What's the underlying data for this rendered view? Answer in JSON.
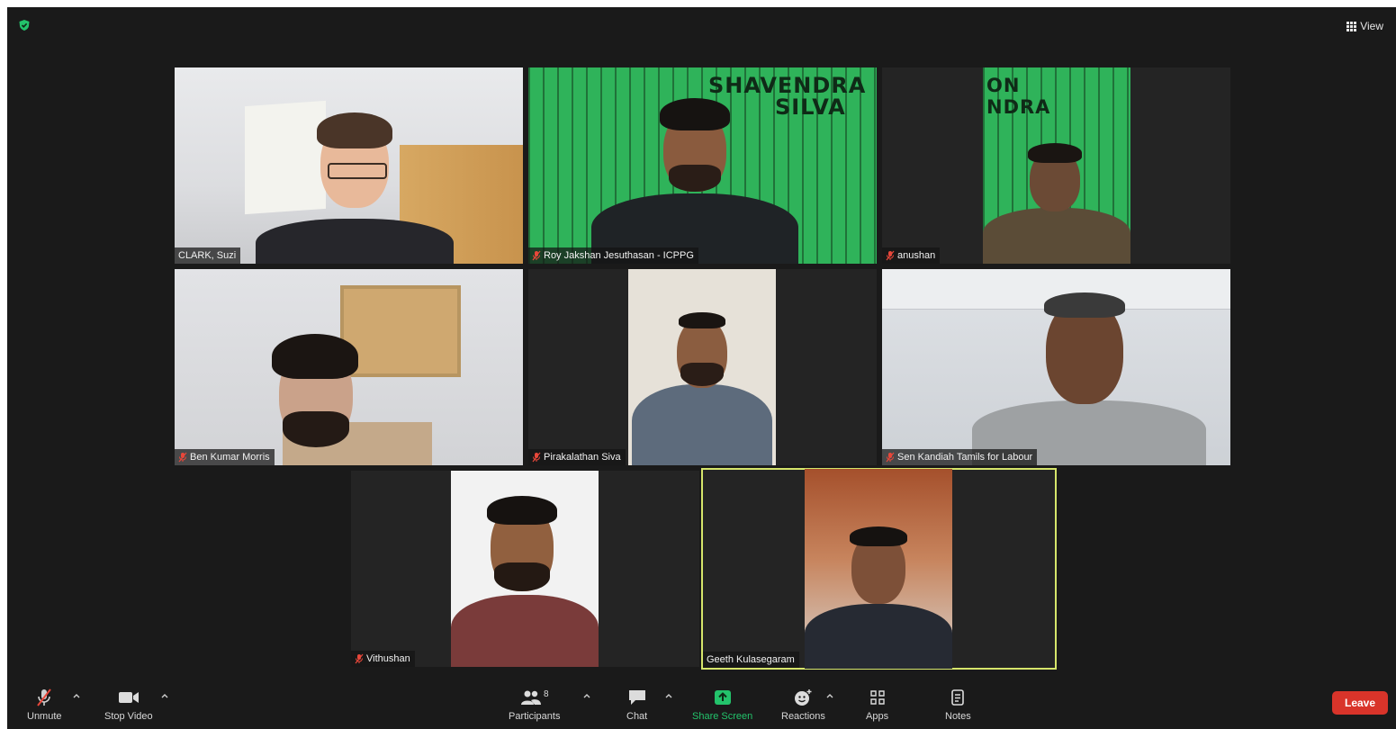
{
  "header": {
    "view_label": "View"
  },
  "participants": [
    {
      "name": "CLARK, Suzi",
      "muted": false
    },
    {
      "name": "Roy Jakshan Jesuthasan - ICPPG",
      "muted": true
    },
    {
      "name": "anushan",
      "muted": true
    },
    {
      "name": "Ben Kumar Morris",
      "muted": true
    },
    {
      "name": "Pirakalathan Siva",
      "muted": true
    },
    {
      "name": "Sen Kandiah Tamils for Labour",
      "muted": true
    },
    {
      "name": "Vithushan",
      "muted": true
    },
    {
      "name": "Geeth Kulasegaram",
      "muted": false,
      "active_speaker": true
    }
  ],
  "posters": {
    "roy": {
      "lines": [
        "SHAVENDRA",
        "SILVA"
      ]
    },
    "anushan": {
      "lines": [
        "ON",
        "NDRA"
      ]
    }
  },
  "toolbar": {
    "unmute_label": "Unmute",
    "stop_video_label": "Stop Video",
    "participants_label": "Participants",
    "participants_count": "8",
    "chat_label": "Chat",
    "share_screen_label": "Share Screen",
    "reactions_label": "Reactions",
    "apps_label": "Apps",
    "notes_label": "Notes",
    "leave_label": "Leave"
  },
  "colors": {
    "background": "#1a1a1a",
    "tile": "#242424",
    "active_speaker_border": "#d6e56b",
    "share_green": "#23c36b",
    "leave_red": "#d9342a",
    "mute_red": "#e8473a",
    "poster_green": "#2fb35a"
  }
}
